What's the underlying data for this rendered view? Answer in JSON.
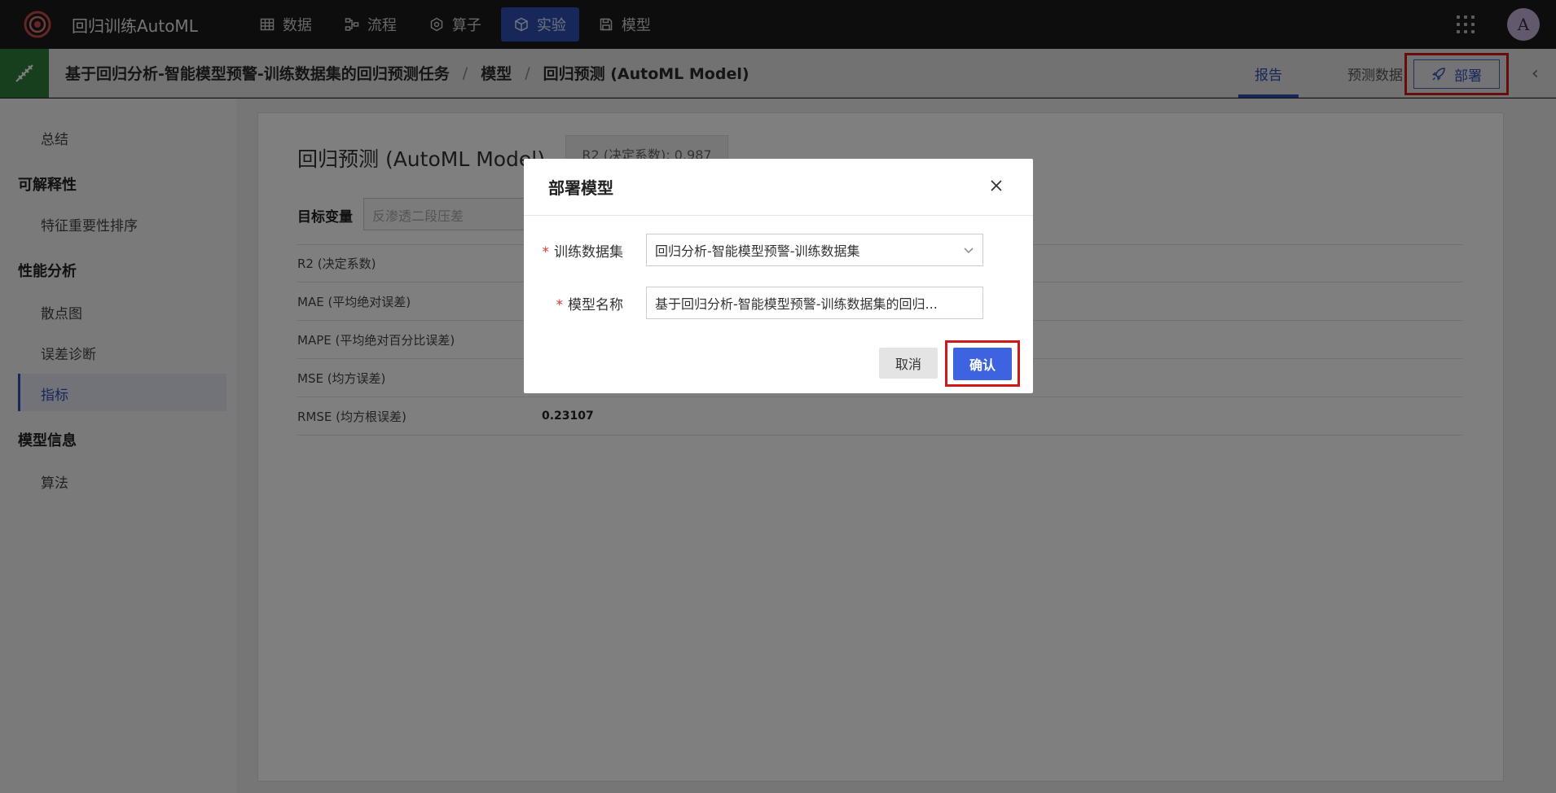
{
  "app": {
    "title": "回归训练AutoML"
  },
  "nav": {
    "items": [
      {
        "label": "数据",
        "icon": "table-icon"
      },
      {
        "label": "流程",
        "icon": "flow-icon"
      },
      {
        "label": "算子",
        "icon": "operator-icon"
      },
      {
        "label": "实验",
        "icon": "cube-icon",
        "active": true
      },
      {
        "label": "模型",
        "icon": "save-icon"
      }
    ]
  },
  "user": {
    "avatar_letter": "A"
  },
  "header": {
    "breadcrumb": [
      "基于回归分析-智能模型预警-训练数据集的回归预测任务",
      "模型",
      "回归预测 (AutoML Model)"
    ],
    "separator": "/",
    "tabs": [
      {
        "label": "报告",
        "active": true
      },
      {
        "label": "预测数据"
      }
    ],
    "deploy_label": "部署",
    "collapse_glyph": "‹"
  },
  "sidebar": {
    "summary": "总结",
    "group_explain": "可解释性",
    "feature_importance": "特征重要性排序",
    "group_perf": "性能分析",
    "scatter": "散点图",
    "error_diag": "误差诊断",
    "metrics": "指标",
    "group_model": "模型信息",
    "algorithm": "算法"
  },
  "main": {
    "title": "回归预测 (AutoML Model)",
    "r2_chip": "R2 (决定系数): 0.987",
    "target_label": "目标变量",
    "target_value": "反渗透二段压差",
    "metrics": [
      {
        "name": "R2 (决定系数)",
        "value": ""
      },
      {
        "name": "MAE (平均绝对误差)",
        "value": ""
      },
      {
        "name": "MAPE (平均绝对百分比误差)",
        "value": ""
      },
      {
        "name": "MSE (均方误差)",
        "value": ""
      },
      {
        "name": "RMSE (均方根误差)",
        "value": "0.23107"
      }
    ]
  },
  "modal": {
    "title": "部署模型",
    "required_mark": "*",
    "dataset_label": "训练数据集",
    "dataset_value": "回归分析-智能模型预警-训练数据集",
    "name_label": "模型名称",
    "name_value": "基于回归分析-智能模型预警-训练数据集的回归...",
    "cancel_label": "取消",
    "confirm_label": "确认"
  },
  "colors": {
    "accent": "#2f4fb5",
    "confirm": "#3d63e0",
    "highlight": "#d01818",
    "header_icon_bg": "#2e7d3a"
  }
}
